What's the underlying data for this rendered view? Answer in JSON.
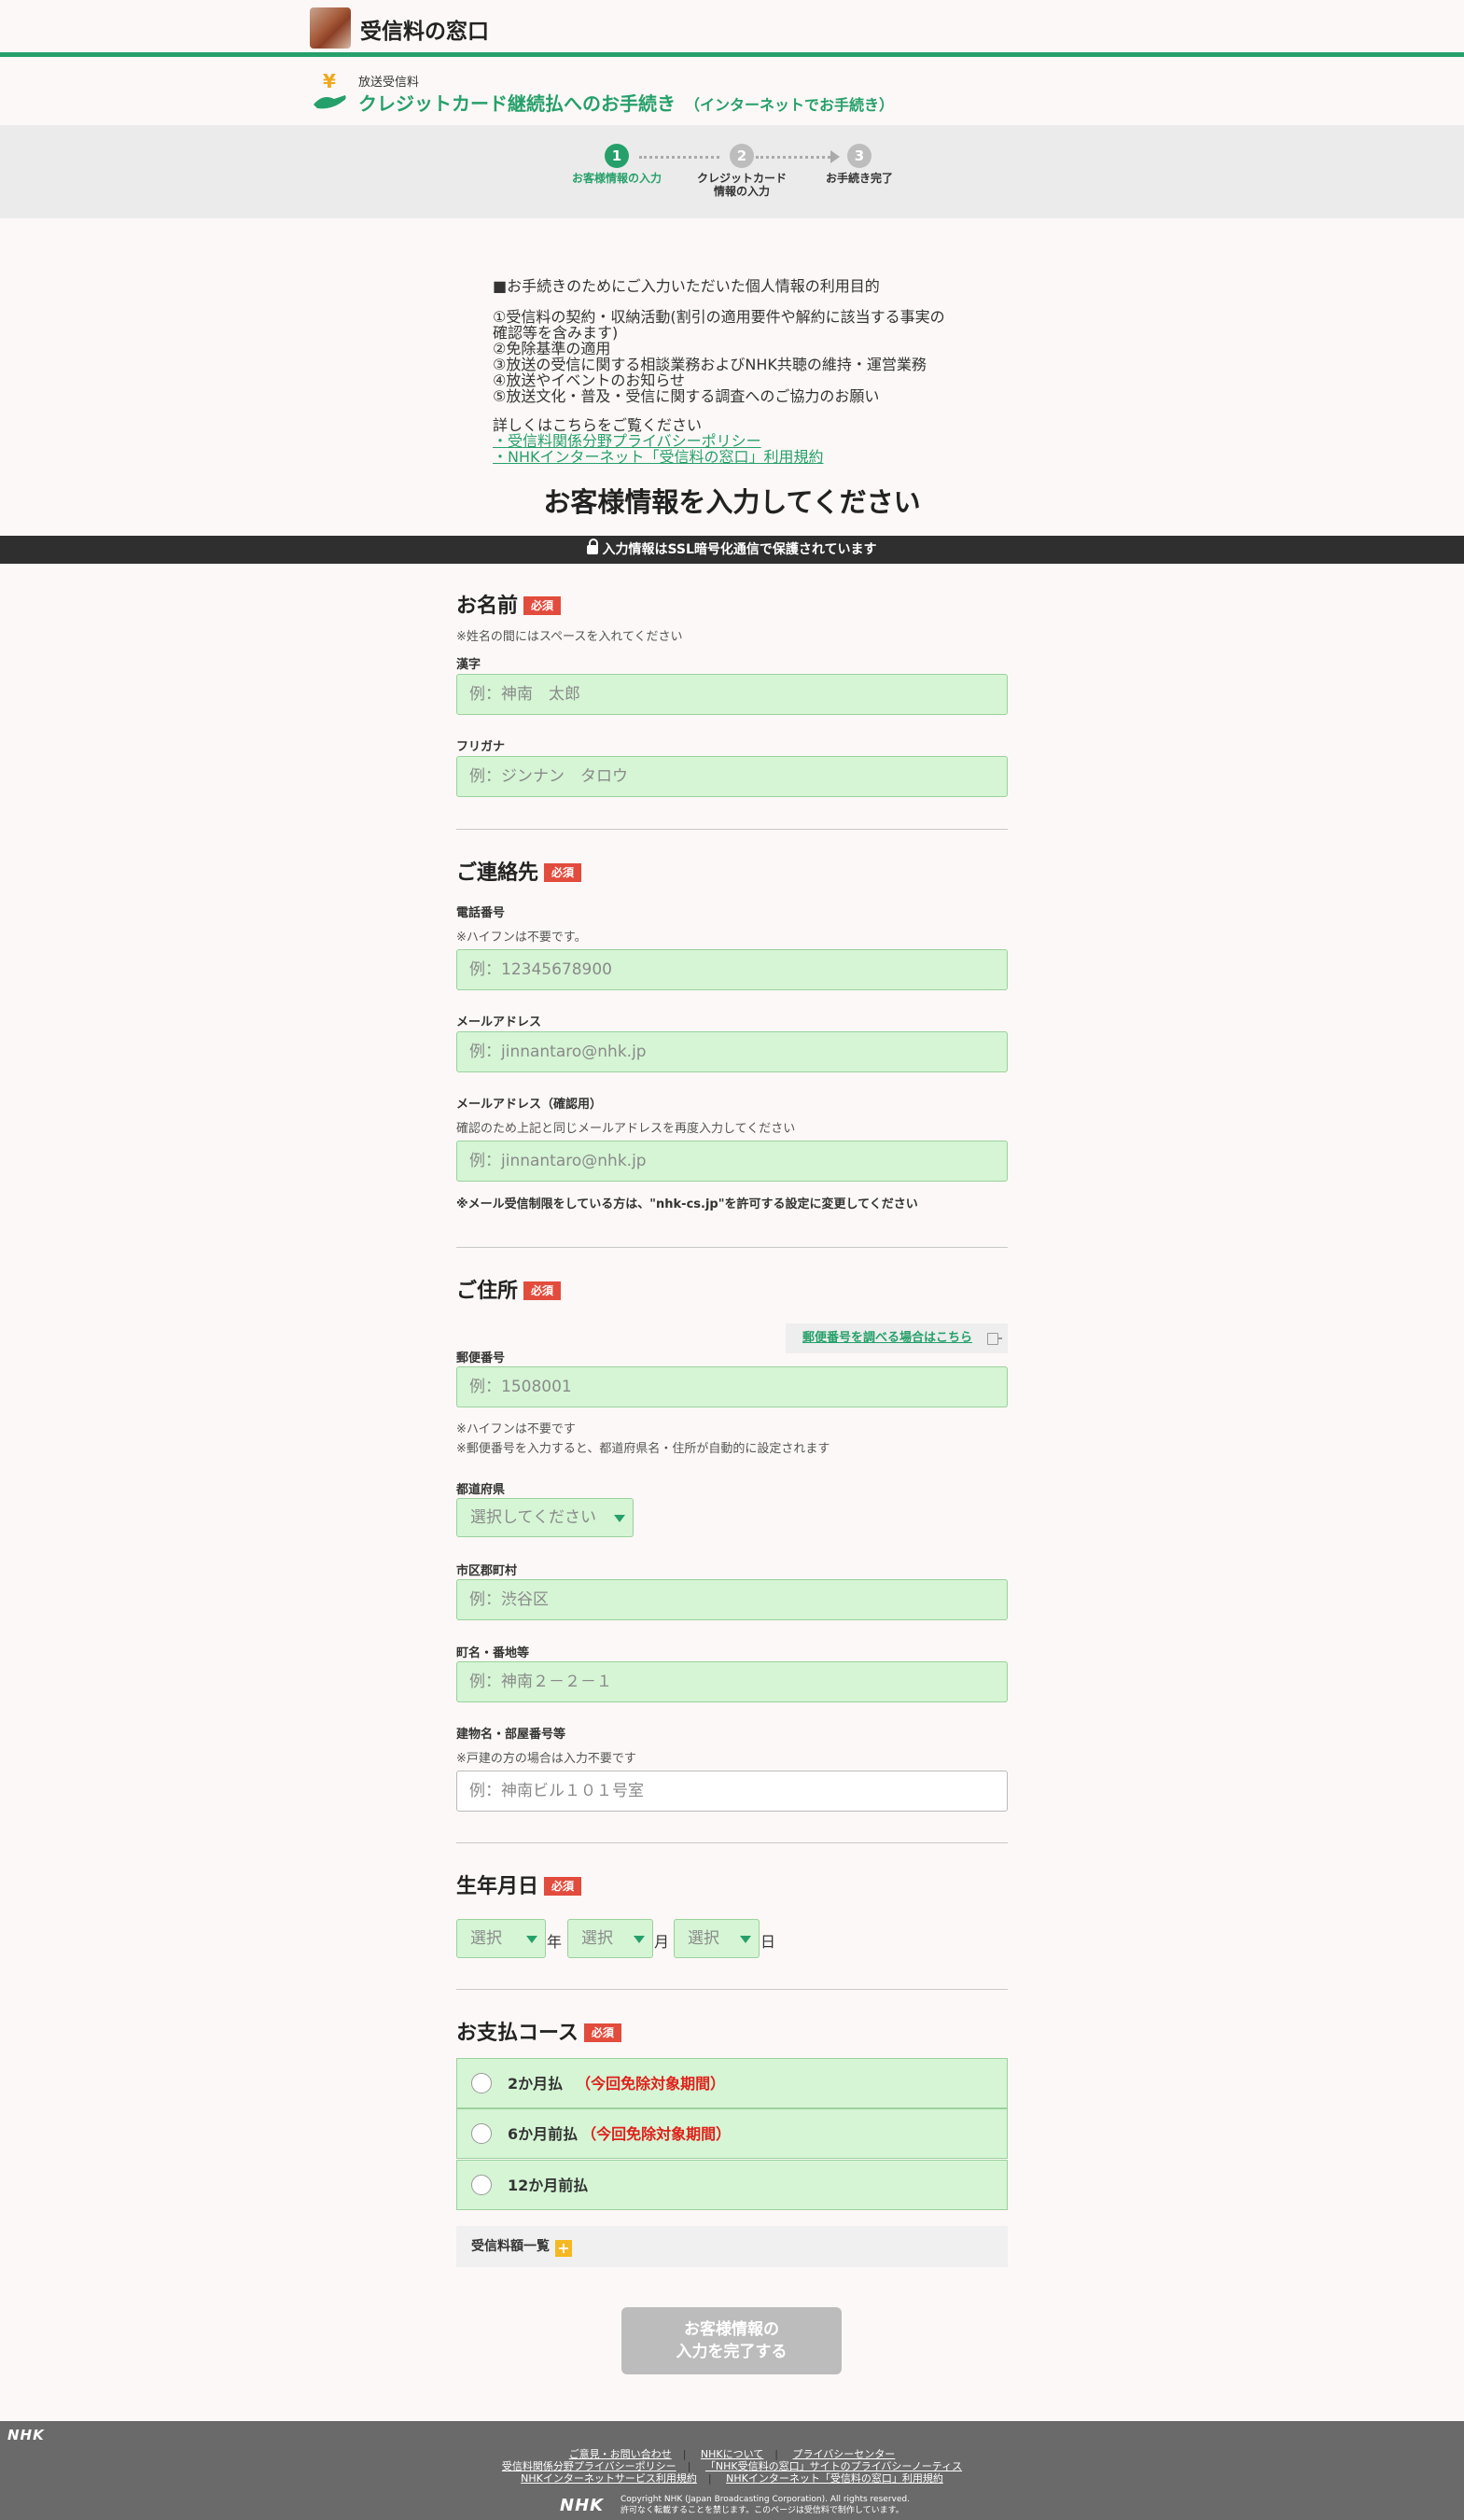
{
  "header": {
    "site_name": "受信料の窓口"
  },
  "subheader": {
    "kicker": "放送受信料",
    "title": "クレジットカード継続払へのお手続き",
    "title_sub": "（インターネットでお手続き）"
  },
  "steps": [
    {
      "num": "1",
      "label_1": "お客様情報の入力",
      "label_2": "",
      "active": true
    },
    {
      "num": "2",
      "label_1": "クレジットカード",
      "label_2": "情報の入力",
      "active": false
    },
    {
      "num": "3",
      "label_1": "お手続き完了",
      "label_2": "",
      "active": false
    }
  ],
  "privacy": {
    "heading": "■お手続きのためにご入力いただいた個人情報の利用目的",
    "lines": [
      "①受信料の契約・収納活動(割引の適用要件や解約に該当する事実の",
      "確認等を含みます)",
      "②免除基準の適用",
      "③放送の受信に関する相談業務およびNHK共聴の維持・運営業務",
      "④放送やイベントのお知らせ",
      "⑤放送文化・普及・受信に関する調査へのご協力のお願い"
    ],
    "more": "詳しくはこちらをご覧ください",
    "link_1": "・受信料関係分野プライバシーポリシー",
    "link_2": "・NHKインターネット「受信料の窓口」利用規約"
  },
  "page_title": "お客様情報を入力してください",
  "ssl_notice": "入力情報はSSL暗号化通信で保護されています",
  "required_badge": "必須",
  "name_section": {
    "title": "お名前",
    "note": "※姓名の間にはスペースを入れてください",
    "kanji_label": "漢字",
    "kanji_placeholder": "例：神南　太郎",
    "furigana_label": "フリガナ",
    "furigana_placeholder": "例：ジンナン　タロウ"
  },
  "contact_section": {
    "title": "ご連絡先",
    "phone_label": "電話番号",
    "phone_note": "※ハイフンは不要です。",
    "phone_placeholder": "例：12345678900",
    "email_label": "メールアドレス",
    "email_placeholder": "例：jinnantaro@nhk.jp",
    "email_confirm_label": "メールアドレス（確認用）",
    "email_confirm_note": "確認のため上記と同じメールアドレスを再度入力してください",
    "email_confirm_placeholder": "例：jinnantaro@nhk.jp",
    "mail_warning": "※メール受信制限をしている方は、\"nhk-cs.jp\"を許可する設定に変更してください"
  },
  "address_section": {
    "title": "ご住所",
    "zip_lookup_link": "郵便番号を調べる場合はこちら",
    "zip_label": "郵便番号",
    "zip_placeholder": "例：1508001",
    "zip_note_1": "※ハイフンは不要です",
    "zip_note_2": "※郵便番号を入力すると、都道府県名・住所が自動的に設定されます",
    "pref_label": "都道府県",
    "pref_selected": "選択してください",
    "city_label": "市区郡町村",
    "city_placeholder": "例：渋谷区",
    "town_label": "町名・番地等",
    "town_placeholder": "例：神南２－２－１",
    "building_label": "建物名・部屋番号等",
    "building_note": "※戸建の方の場合は入力不要です",
    "building_placeholder": "例：神南ビル１０１号室"
  },
  "birth_section": {
    "title": "生年月日",
    "year_selected": "選択",
    "year_unit": "年",
    "month_selected": "選択",
    "month_unit": "月",
    "day_selected": "選択",
    "day_unit": "日"
  },
  "payment_section": {
    "title": "お支払コース",
    "options": [
      {
        "label": "2か月払",
        "note": "（今回免除対象期間）"
      },
      {
        "label": "6か月前払",
        "note": "（今回免除対象期間）"
      },
      {
        "label": "12か月前払",
        "note": ""
      }
    ],
    "fee_list": "受信料額一覧",
    "fee_icon": "+"
  },
  "submit": {
    "line_1": "お客様情報の",
    "line_2": "入力を完了する"
  },
  "footer": {
    "brand": "NHK",
    "row_1": [
      "ご意見・お問い合わせ",
      "NHKについて",
      "プライバシーセンター"
    ],
    "row_2": [
      "受信料関係分野プライバシーポリシー",
      "「NHK受信料の窓口」サイトのプライバシーノーティス"
    ],
    "row_3": [
      "NHKインターネットサービス利用規約",
      "NHKインターネット「受信料の窓口」利用規約"
    ],
    "copyright_1": "Copyright NHK (Japan Broadcasting Corporation). All rights reserved.",
    "copyright_2": "許可なく転載することを禁じます。このページは受信料で制作しています。"
  },
  "colors": {
    "brand_green": "#26a06a",
    "field_bg": "#d5f5d5",
    "required_red": "#e24c3d",
    "footer_gray": "#6a6a6a"
  }
}
